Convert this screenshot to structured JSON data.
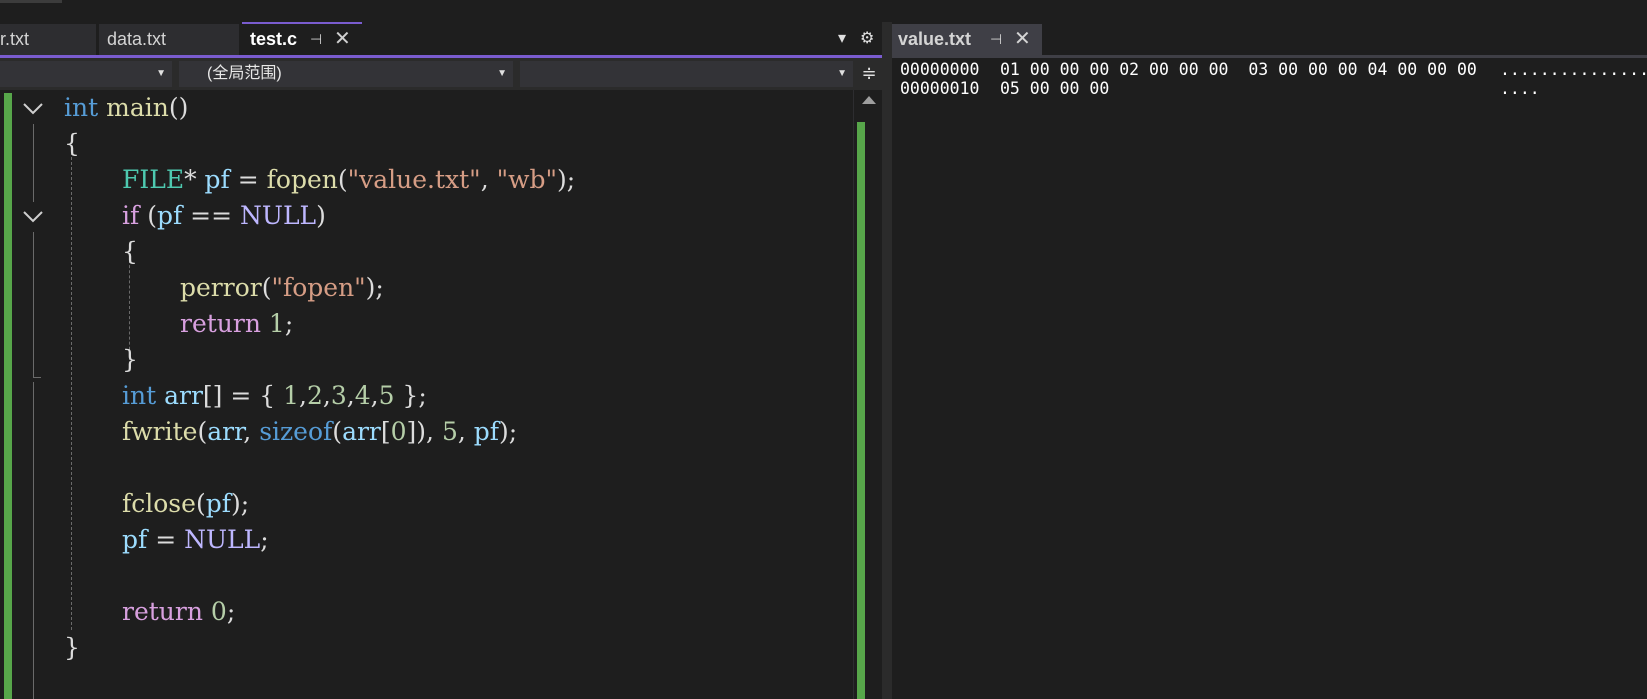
{
  "left_tabs": [
    {
      "label": "r.txt"
    },
    {
      "label": "data.txt"
    },
    {
      "label": "test.c",
      "active": true
    }
  ],
  "tab_icons": {
    "pin": "pin-icon",
    "close": "close-icon",
    "overflow": "chevron-down-icon",
    "settings": "gear-icon"
  },
  "nav": {
    "project": "",
    "scope": "(全局范围)",
    "member": ""
  },
  "code_lines": [
    [
      [
        "kw",
        "int"
      ],
      [
        "pun",
        " "
      ],
      [
        "fn",
        "main"
      ],
      [
        "pun",
        "()"
      ]
    ],
    [
      [
        "pun",
        "{"
      ]
    ],
    [
      [
        "ty",
        "FILE"
      ],
      [
        "pun",
        "* "
      ],
      [
        "var",
        "pf"
      ],
      [
        "pun",
        " = "
      ],
      [
        "fn",
        "fopen"
      ],
      [
        "pun",
        "("
      ],
      [
        "str",
        "\"value.txt\""
      ],
      [
        "pun",
        ", "
      ],
      [
        "str",
        "\"wb\""
      ],
      [
        "pun",
        ");"
      ]
    ],
    [
      [
        "ctl",
        "if"
      ],
      [
        "pun",
        " ("
      ],
      [
        "var",
        "pf"
      ],
      [
        "pun",
        " == "
      ],
      [
        "mac",
        "NULL"
      ],
      [
        "pun",
        ")"
      ]
    ],
    [
      [
        "pun",
        "{"
      ]
    ],
    [
      [
        "fn",
        "perror"
      ],
      [
        "pun",
        "("
      ],
      [
        "str",
        "\"fopen\""
      ],
      [
        "pun",
        ");"
      ]
    ],
    [
      [
        "ctl",
        "return"
      ],
      [
        "pun",
        " "
      ],
      [
        "num",
        "1"
      ],
      [
        "pun",
        ";"
      ]
    ],
    [
      [
        "pun",
        "}"
      ]
    ],
    [
      [
        "kw",
        "int"
      ],
      [
        "pun",
        " "
      ],
      [
        "var",
        "arr"
      ],
      [
        "pun",
        "[] = { "
      ],
      [
        "num",
        "1"
      ],
      [
        "pun",
        ","
      ],
      [
        "num",
        "2"
      ],
      [
        "pun",
        ","
      ],
      [
        "num",
        "3"
      ],
      [
        "pun",
        ","
      ],
      [
        "num",
        "4"
      ],
      [
        "pun",
        ","
      ],
      [
        "num",
        "5"
      ],
      [
        "pun",
        " };"
      ]
    ],
    [
      [
        "fn",
        "fwrite"
      ],
      [
        "pun",
        "("
      ],
      [
        "var",
        "arr"
      ],
      [
        "pun",
        ", "
      ],
      [
        "kw",
        "sizeof"
      ],
      [
        "pun",
        "("
      ],
      [
        "var",
        "arr"
      ],
      [
        "pun",
        "["
      ],
      [
        "num",
        "0"
      ],
      [
        "pun",
        "]), "
      ],
      [
        "num",
        "5"
      ],
      [
        "pun",
        ", "
      ],
      [
        "var",
        "pf"
      ],
      [
        "pun",
        ");"
      ]
    ],
    [],
    [
      [
        "fn",
        "fclose"
      ],
      [
        "pun",
        "("
      ],
      [
        "var",
        "pf"
      ],
      [
        "pun",
        ");"
      ]
    ],
    [
      [
        "var",
        "pf"
      ],
      [
        "pun",
        " = "
      ],
      [
        "mac",
        "NULL"
      ],
      [
        "pun",
        ";"
      ]
    ],
    [],
    [
      [
        "ctl",
        "return"
      ],
      [
        "pun",
        " "
      ],
      [
        "num",
        "0"
      ],
      [
        "pun",
        ";"
      ]
    ],
    [
      [
        "pun",
        "}"
      ]
    ]
  ],
  "right_tab": {
    "label": "value.txt"
  },
  "hex_rows": [
    {
      "addr": "00000000",
      "bytes": "01 00 00 00 02 00 00 00  03 00 00 00 04 00 00 00",
      "ascii": "................"
    },
    {
      "addr": "00000010",
      "bytes": "05 00 00 00",
      "ascii": "...."
    }
  ],
  "colors": {
    "accent": "#7a5ccf",
    "change_bar": "#57a64a"
  }
}
